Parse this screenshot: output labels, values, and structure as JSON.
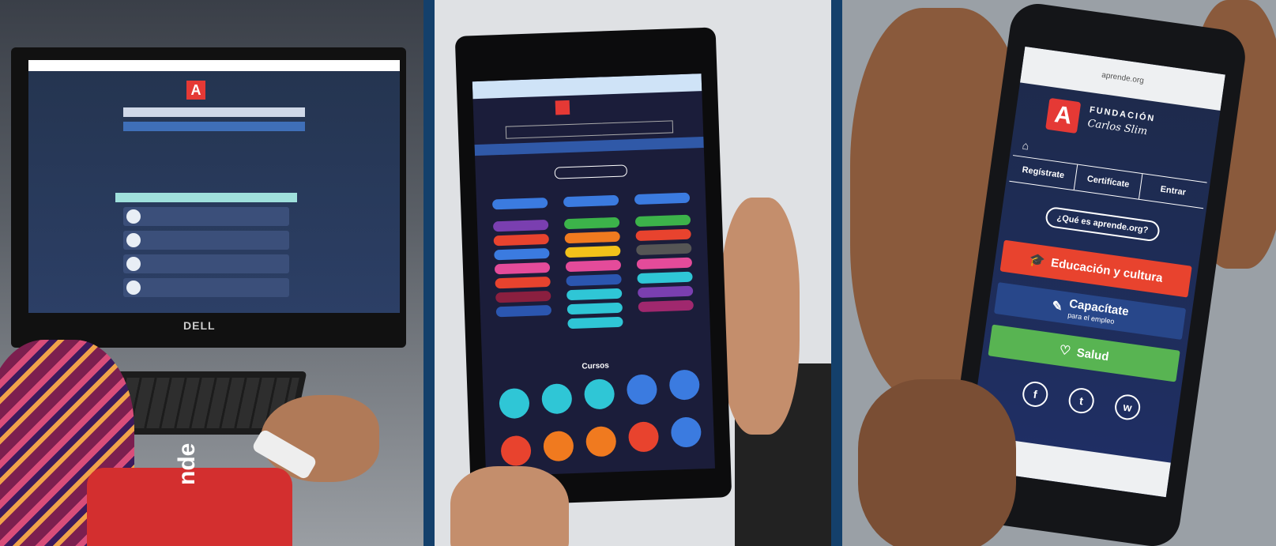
{
  "desktop": {
    "monitor_brand": "DELL",
    "badge_text": "nde"
  },
  "tablet": {
    "section_title": "Cursos"
  },
  "phone": {
    "status_url": "aprende.org",
    "brand_line1": "FUNDACIÓN",
    "brand_line2": "Carlos Slim",
    "logo_letter": "A",
    "nav": [
      "Regístrate",
      "Certifícate",
      "Entrar"
    ],
    "about_button": "¿Qué es aprende.org?",
    "buttons": {
      "education": "Educación y cultura",
      "training": "Capacítate",
      "training_sub": "para el empleo",
      "health": "Salud"
    },
    "social_icons": [
      "f",
      "t",
      "w"
    ],
    "colors": {
      "education": "#e8432e",
      "training": "#28478a",
      "health": "#58b452",
      "logo": "#e53935"
    }
  }
}
